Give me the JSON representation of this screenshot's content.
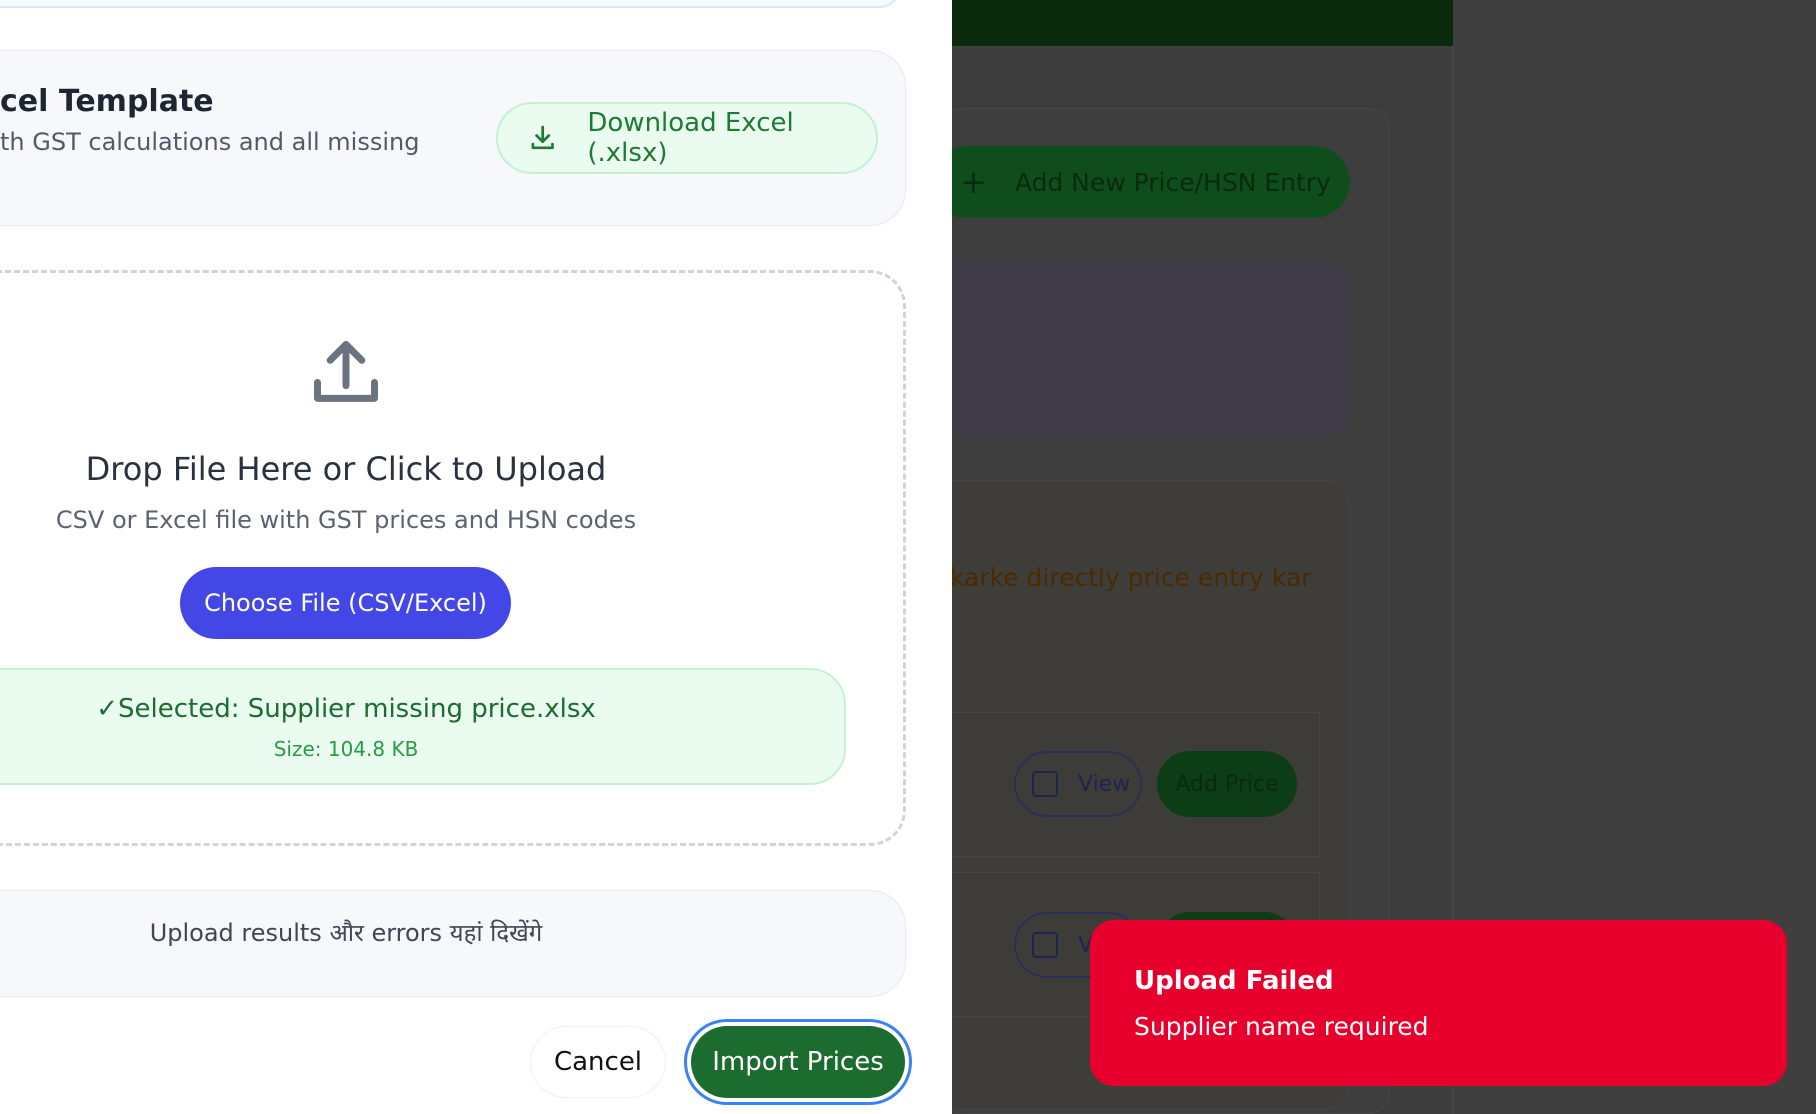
{
  "background": {
    "add_entry_label": "Add New Price/HSN Entry",
    "notice_text": "karke directly price entry kar",
    "rows": [
      {
        "view_label": "View",
        "add_price_label": "Add Price"
      },
      {
        "view_label": "V",
        "add_price_label": ""
      }
    ]
  },
  "modal": {
    "template": {
      "title": "cel Template",
      "subtitle": "th GST calculations and all missing",
      "download_label": "Download Excel (.xlsx)"
    },
    "drop_zone": {
      "title": "Drop File Here or Click to Upload",
      "subtitle": "CSV or Excel file with GST prices and HSN codes",
      "choose_label": "Choose File (CSV/Excel)"
    },
    "selected_file": {
      "name": "✓Selected: Supplier missing price.xlsx",
      "size": "Size: 104.8 KB"
    },
    "results_placeholder": "Upload results और errors यहां दिखेंगे",
    "cancel_label": "Cancel",
    "import_label": "Import Prices"
  },
  "toast": {
    "title": "Upload Failed",
    "message": "Supplier name required"
  },
  "colors": {
    "accent_green": "#1c6b2f",
    "accent_blue": "#4347e6",
    "error_red": "#e8002c",
    "focus_ring": "#3b82f6"
  }
}
